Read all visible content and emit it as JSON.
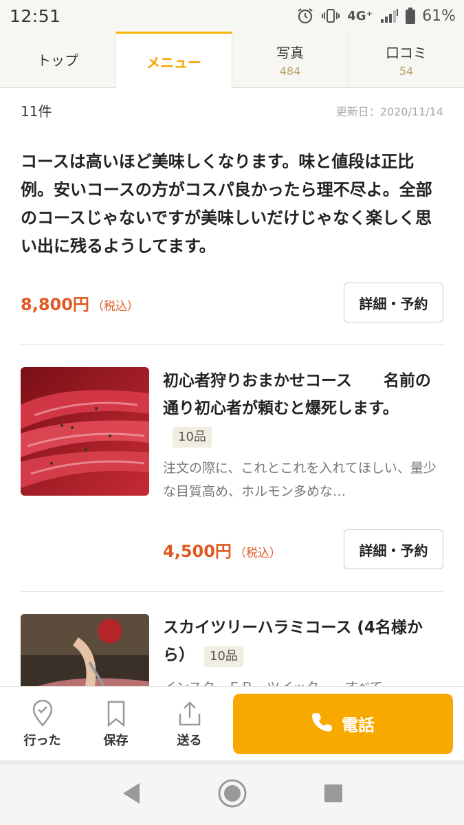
{
  "status_bar": {
    "time": "12:51",
    "network": "4G⁺",
    "battery": "61%"
  },
  "tabs": [
    {
      "label": "トップ",
      "count": ""
    },
    {
      "label": "メニュー",
      "count": ""
    },
    {
      "label": "写真",
      "count": "484"
    },
    {
      "label": "口コミ",
      "count": "54"
    }
  ],
  "active_tab": "メニュー",
  "meta": {
    "count": "11件",
    "updated": "更新日：2020/11/14"
  },
  "courses": [
    {
      "title": "コースは高いほど美味しくなります。味と値段は正比例。安いコースの方がコスパ良かったら理不尽よ。全部のコースじゃないですが美味しいだけじゃなく楽しく思い出に残るようしてます。",
      "price": "8,800円",
      "tax": "（税込）",
      "button": "詳細・予約"
    },
    {
      "title": "初心者狩りおまかせコース　　名前の通り初心者が頼むと爆死します。",
      "badge": "10品",
      "description": "注文の際に、これとこれを入れてほしい、量少な目質高め、ホルモン多めな…",
      "price": "4,500円",
      "tax": "（税込）",
      "button": "詳細・予約",
      "image": "beef-photo"
    },
    {
      "title": "スカイツリーハラミコース (4名様から）",
      "badge": "10品",
      "description": "インスタ、ＦＢ、ツイッター、すべて",
      "image": "harami-photo"
    }
  ],
  "action_bar": {
    "went": "行った",
    "save": "保存",
    "send": "送る",
    "call": "電話"
  },
  "colors": {
    "accent": "#f8a900",
    "price": "#e05a24",
    "tab_active": "#f5a300"
  }
}
